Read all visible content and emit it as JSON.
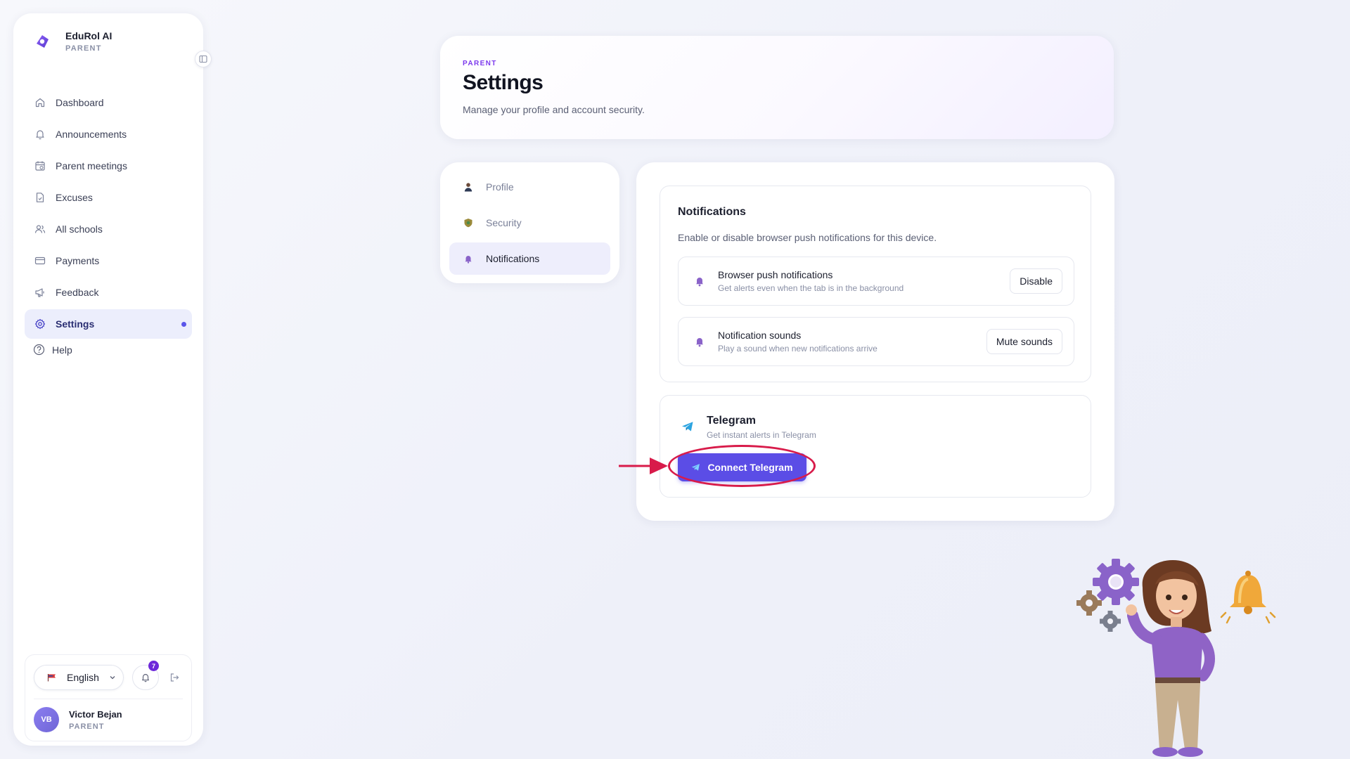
{
  "brand": {
    "name": "EduRol AI",
    "role": "PARENT"
  },
  "sidebar": {
    "items": [
      {
        "label": "Dashboard",
        "icon": "home-icon"
      },
      {
        "label": "Announcements",
        "icon": "bell-icon"
      },
      {
        "label": "Parent meetings",
        "icon": "calendar-icon"
      },
      {
        "label": "Excuses",
        "icon": "document-icon"
      },
      {
        "label": "All schools",
        "icon": "users-icon"
      },
      {
        "label": "Payments",
        "icon": "card-icon"
      },
      {
        "label": "Feedback",
        "icon": "megaphone-icon"
      },
      {
        "label": "Settings",
        "icon": "gear-icon",
        "active": true
      }
    ],
    "help_label": "Help"
  },
  "footer": {
    "language": "English",
    "notification_count": "7",
    "user_initials": "VB",
    "user_name": "Victor Bejan",
    "user_role": "PARENT"
  },
  "header": {
    "eyebrow": "PARENT",
    "title": "Settings",
    "subtitle": "Manage your profile and account security."
  },
  "tabs": [
    {
      "label": "Profile",
      "icon": "person-icon"
    },
    {
      "label": "Security",
      "icon": "shield-icon"
    },
    {
      "label": "Notifications",
      "icon": "bell-icon",
      "active": true
    }
  ],
  "notifications": {
    "title": "Notifications",
    "description": "Enable or disable browser push notifications for this device.",
    "rows": [
      {
        "title": "Browser push notifications",
        "subtitle": "Get alerts even when the tab is in the background",
        "button": "Disable"
      },
      {
        "title": "Notification sounds",
        "subtitle": "Play a sound when new notifications arrive",
        "button": "Mute sounds"
      }
    ]
  },
  "telegram": {
    "title": "Telegram",
    "subtitle": "Get instant alerts in Telegram",
    "button": "Connect Telegram"
  },
  "colors": {
    "accent": "#5b4de6",
    "brand_purple": "#7c3aed",
    "annotation_red": "#d81b4a",
    "active_nav_bg": "#eceefc"
  }
}
